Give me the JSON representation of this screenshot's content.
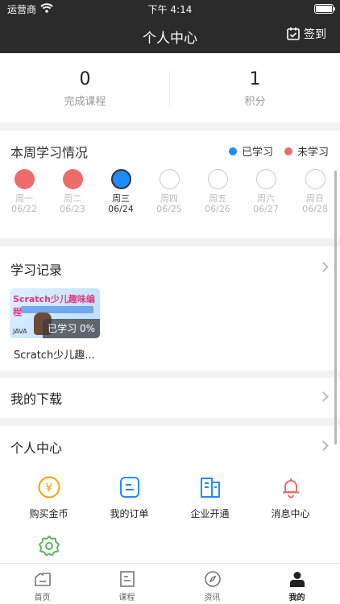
{
  "status_bar": {
    "carrier": "运营商",
    "time": "下午 4:14"
  },
  "nav": {
    "title": "个人中心",
    "checkin_label": "签到"
  },
  "stats": [
    {
      "value": "0",
      "label": "完成课程"
    },
    {
      "value": "1",
      "label": "积分"
    }
  ],
  "weekly": {
    "title": "本周学习情况",
    "legend": [
      {
        "label": "已学习",
        "color": "#1f8cff"
      },
      {
        "label": "未学习",
        "color": "#ee6b6b"
      }
    ],
    "days": [
      {
        "name": "周一",
        "date": "06/22",
        "state": "red"
      },
      {
        "name": "周二",
        "date": "06/23",
        "state": "red"
      },
      {
        "name": "周三",
        "date": "06/24",
        "state": "blue"
      },
      {
        "name": "周四",
        "date": "06/25",
        "state": "empty"
      },
      {
        "name": "周五",
        "date": "06/26",
        "state": "empty"
      },
      {
        "name": "周六",
        "date": "06/27",
        "state": "empty"
      },
      {
        "name": "周日",
        "date": "06/28",
        "state": "empty"
      }
    ]
  },
  "records": {
    "title": "学习记录",
    "course": {
      "thumb_title": "Scratch少儿趣味编程",
      "thumb_code": "JAVA",
      "progress": "已学习 0%",
      "name": "Scratch少儿趣..."
    }
  },
  "downloads": {
    "title": "我的下载"
  },
  "center": {
    "title": "个人中心",
    "items": [
      {
        "label": "购买金币",
        "icon": "coin-icon"
      },
      {
        "label": "我的订单",
        "icon": "order-icon"
      },
      {
        "label": "企业开通",
        "icon": "enterprise-icon"
      },
      {
        "label": "消息中心",
        "icon": "bell-icon"
      },
      {
        "label": "",
        "icon": "settings-icon"
      }
    ]
  },
  "tabs": [
    {
      "label": "首页",
      "icon": "home-icon"
    },
    {
      "label": "课程",
      "icon": "course-icon"
    },
    {
      "label": "资讯",
      "icon": "compass-icon"
    },
    {
      "label": "我的",
      "icon": "user-icon"
    }
  ],
  "colors": {
    "learned": "#1f8cff",
    "not_learned": "#ee6b6b",
    "header_bg": "#2b2b2b"
  }
}
